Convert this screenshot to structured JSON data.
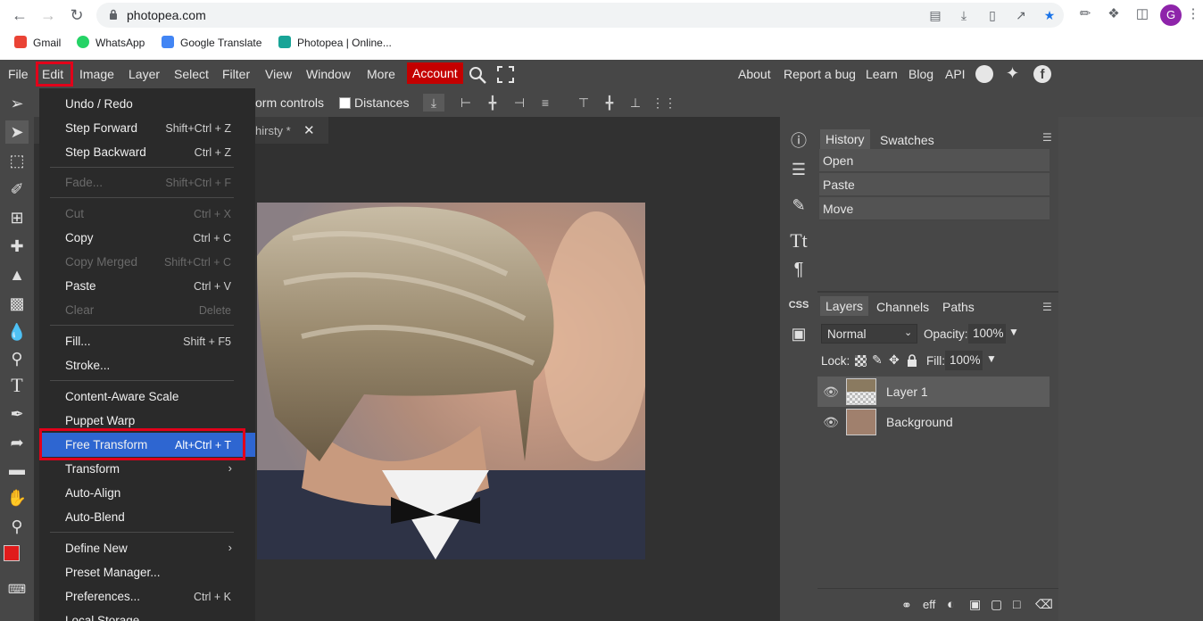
{
  "browser": {
    "url": "photopea.com",
    "avatar_letter": "G",
    "bookmarks": [
      "Gmail",
      "WhatsApp",
      "Google Translate",
      "Photopea | Online..."
    ]
  },
  "menubar": {
    "items": [
      "File",
      "Edit",
      "Image",
      "Layer",
      "Select",
      "Filter",
      "View",
      "Window",
      "More"
    ],
    "account": "Account",
    "right_links": [
      "About",
      "Report a bug",
      "Learn",
      "Blog",
      "API"
    ]
  },
  "options": {
    "transform_controls": "orm controls",
    "distances": "Distances"
  },
  "document": {
    "tab_title": "hirsty *",
    "close": "✕"
  },
  "edit_menu": {
    "items": [
      {
        "label": "Undo / Redo",
        "shortcut": "",
        "disabled": false
      },
      {
        "label": "Step Forward",
        "shortcut": "Shift+Ctrl + Z",
        "disabled": false
      },
      {
        "label": "Step Backward",
        "shortcut": "Ctrl + Z",
        "disabled": false
      },
      {
        "label": "Fade...",
        "shortcut": "Shift+Ctrl + F",
        "disabled": true
      },
      {
        "label": "Cut",
        "shortcut": "Ctrl + X",
        "disabled": true
      },
      {
        "label": "Copy",
        "shortcut": "Ctrl + C",
        "disabled": false
      },
      {
        "label": "Copy Merged",
        "shortcut": "Shift+Ctrl + C",
        "disabled": true
      },
      {
        "label": "Paste",
        "shortcut": "Ctrl + V",
        "disabled": false
      },
      {
        "label": "Clear",
        "shortcut": "Delete",
        "disabled": true
      },
      {
        "label": "Fill...",
        "shortcut": "Shift + F5",
        "disabled": false
      },
      {
        "label": "Stroke...",
        "shortcut": "",
        "disabled": false
      },
      {
        "label": "Content-Aware Scale",
        "shortcut": "",
        "disabled": false
      },
      {
        "label": "Puppet Warp",
        "shortcut": "",
        "disabled": false
      },
      {
        "label": "Free Transform",
        "shortcut": "Alt+Ctrl + T",
        "disabled": false
      },
      {
        "label": "Transform",
        "shortcut": "",
        "disabled": false
      },
      {
        "label": "Auto-Align",
        "shortcut": "",
        "disabled": false
      },
      {
        "label": "Auto-Blend",
        "shortcut": "",
        "disabled": false
      },
      {
        "label": "Define New",
        "shortcut": "",
        "disabled": false
      },
      {
        "label": "Preset Manager...",
        "shortcut": "",
        "disabled": false
      },
      {
        "label": "Preferences...",
        "shortcut": "Ctrl + K",
        "disabled": false
      },
      {
        "label": "Local Storage...",
        "shortcut": "",
        "disabled": false
      }
    ]
  },
  "history_panel": {
    "tabs": [
      "History",
      "Swatches"
    ],
    "entries": [
      "Open",
      "Paste",
      "Move"
    ]
  },
  "layers_panel": {
    "tabs": [
      "Layers",
      "Channels",
      "Paths"
    ],
    "blend_mode": "Normal",
    "opacity_label": "Opacity:",
    "opacity": "100%",
    "lock_label": "Lock:",
    "fill_label": "Fill:",
    "fill": "100%",
    "layers": [
      "Layer 1",
      "Background"
    ],
    "footer_eff": "eff"
  },
  "panel_icons": {
    "css": "CSS"
  },
  "colors": {
    "accent_highlight": "#e2001a",
    "menu_selected": "#2e66d1",
    "account_red": "#c40000",
    "foreground_color": "#e01b1b",
    "background_color": "#000000"
  }
}
